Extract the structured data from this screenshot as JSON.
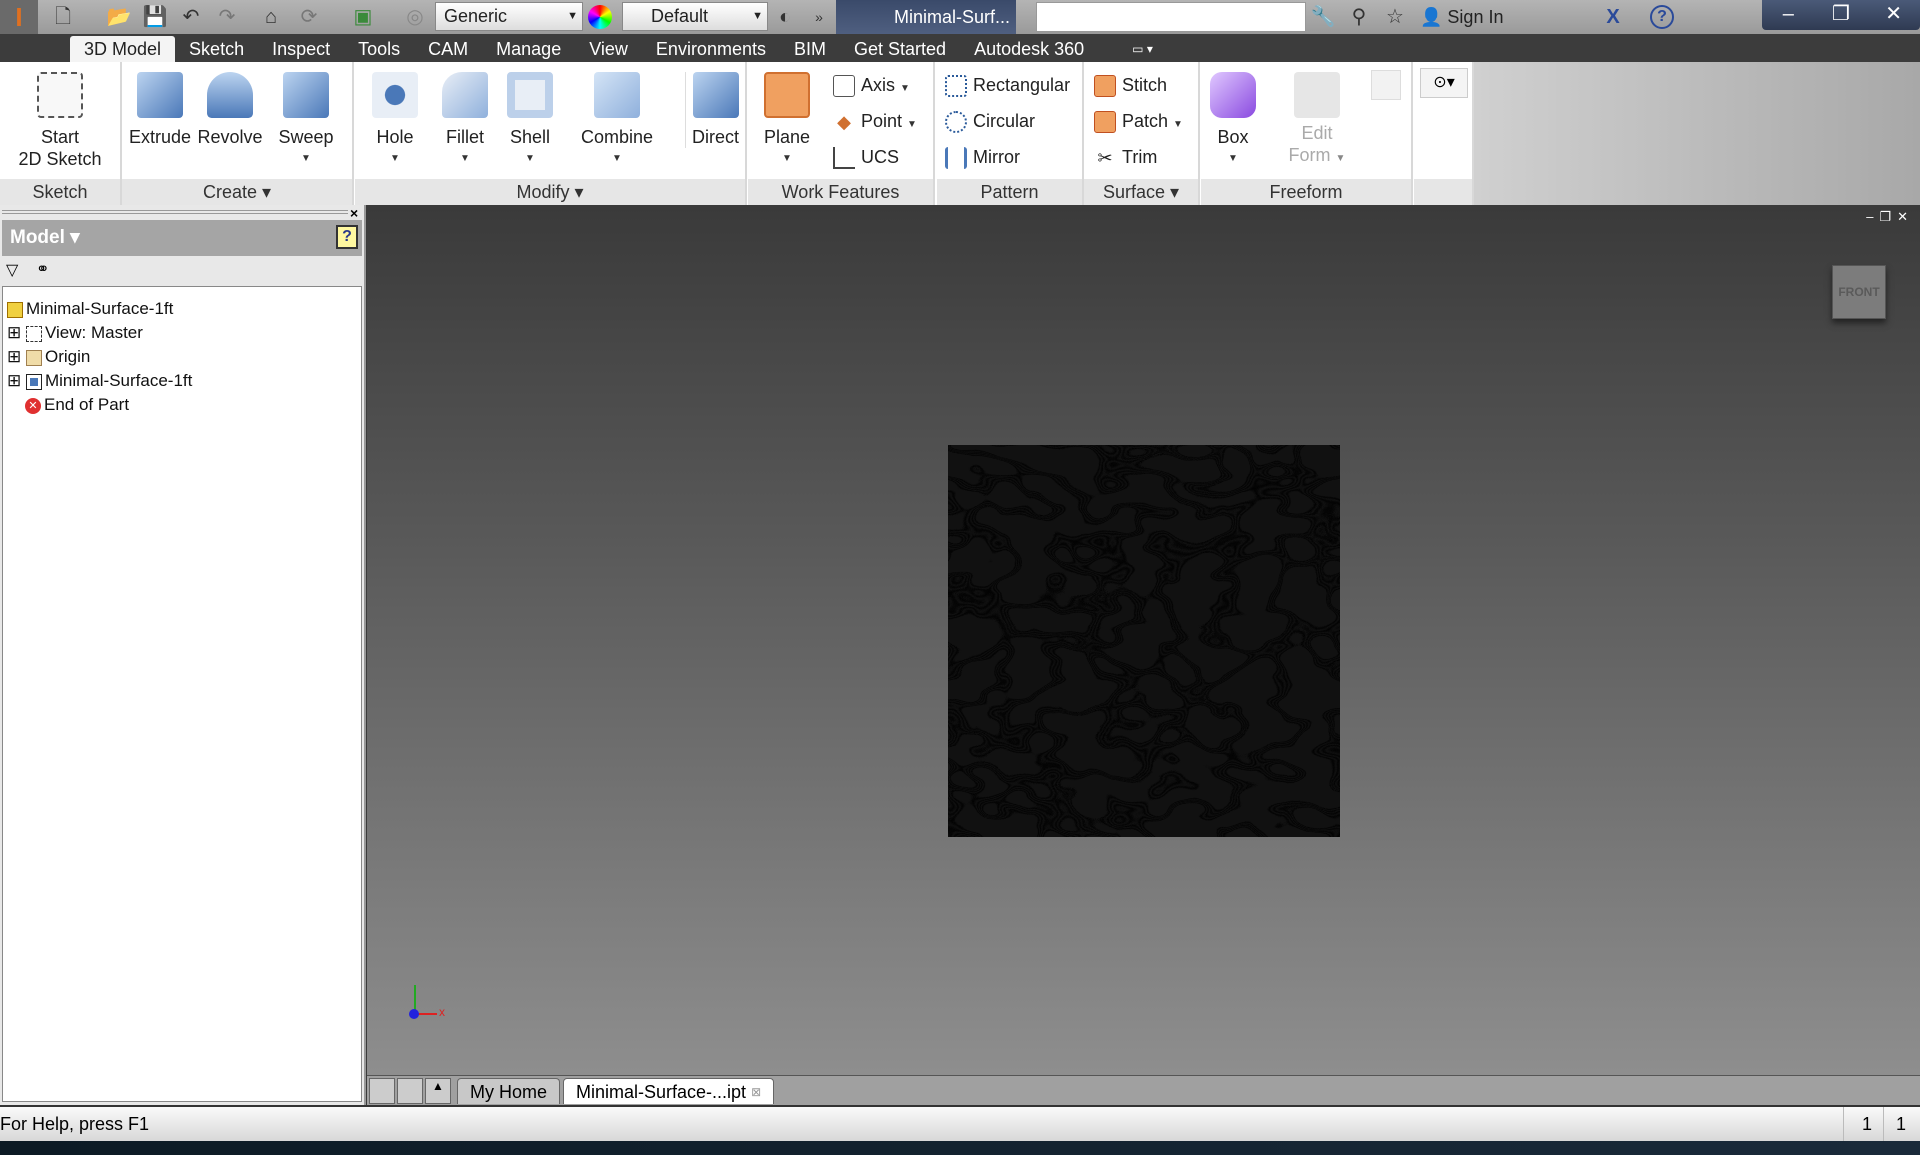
{
  "titlebar": {
    "app_icon": "inventor-logo-icon",
    "material": "Generic",
    "appearance": "Default",
    "title": "Minimal-Surf...",
    "sign_in": "Sign In",
    "help": "?",
    "search_value": ""
  },
  "tabs": [
    "3D Model",
    "Sketch",
    "Inspect",
    "Tools",
    "CAM",
    "Manage",
    "View",
    "Environments",
    "BIM",
    "Get Started",
    "Autodesk 360"
  ],
  "ribbon": {
    "sketch": {
      "label": "Sketch",
      "start": "Start",
      "start2": "2D Sketch"
    },
    "create": {
      "label": "Create",
      "extrude": "Extrude",
      "revolve": "Revolve",
      "sweep": "Sweep"
    },
    "modify": {
      "label": "Modify",
      "hole": "Hole",
      "fillet": "Fillet",
      "shell": "Shell",
      "combine": "Combine",
      "direct": "Direct"
    },
    "work": {
      "label": "Work Features",
      "plane": "Plane",
      "axis": "Axis",
      "point": "Point",
      "ucs": "UCS"
    },
    "pattern": {
      "label": "Pattern",
      "rect": "Rectangular",
      "circ": "Circular",
      "mirror": "Mirror"
    },
    "surface": {
      "label": "Surface",
      "stitch": "Stitch",
      "patch": "Patch",
      "trim": "Trim"
    },
    "freeform": {
      "label": "Freeform",
      "box": "Box",
      "edit": "Edit",
      "edit2": "Form"
    }
  },
  "browser": {
    "title": "Model",
    "help": "?",
    "close": "×",
    "nodes": [
      "Minimal-Surface-1ft",
      "View: Master",
      "Origin",
      "Minimal-Surface-1ft",
      "End of Part"
    ]
  },
  "viewport": {
    "viewcube": "FRONT",
    "axis_x": "x"
  },
  "doctabs": {
    "home": "My Home",
    "doc": "Minimal-Surface-...ipt"
  },
  "status": {
    "help": "For Help, press F1",
    "count1": "1",
    "count2": "1"
  },
  "colors": {
    "accent": "#3c3c3c",
    "title_blue": "#3a4a6a"
  }
}
